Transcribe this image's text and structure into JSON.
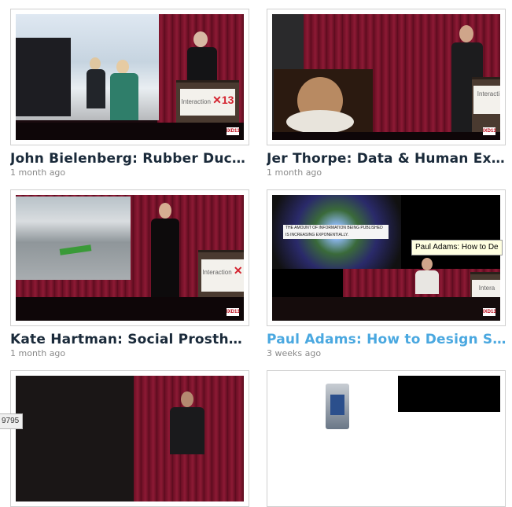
{
  "videos": [
    {
      "title": "John Bielenberg: Rubber Duc…",
      "age": "1 month ago",
      "badge": "IXD13",
      "podium_text": "Interaction",
      "podium_mark": "✕13"
    },
    {
      "title": "Jer Thorpe: Data & Human Ex…",
      "age": "1 month ago",
      "badge": "IXD13",
      "podium_text": "Interacti"
    },
    {
      "title": "Kate Hartman: Social Prosthe…",
      "age": "1 month ago",
      "badge": "IXD13",
      "podium_text": "Interaction",
      "podium_mark": "✕"
    },
    {
      "title": "Paul Adams: How to Design S…",
      "age": "3 weeks ago",
      "badge": "IXD13",
      "slide_text": "THE AMOUNT OF INFORMATION BEING PUBLISHED IS INCREASING EXPONENTIALLY.",
      "podium_text": "Intera"
    },
    {
      "title": "",
      "age": ""
    },
    {
      "title": "",
      "age": ""
    }
  ],
  "tooltip": "Paul Adams: How to De",
  "status_bar": "9795",
  "colors": {
    "title": "#1a2a3a",
    "title_hover": "#4aa8e0",
    "age": "#8a8a8a"
  }
}
